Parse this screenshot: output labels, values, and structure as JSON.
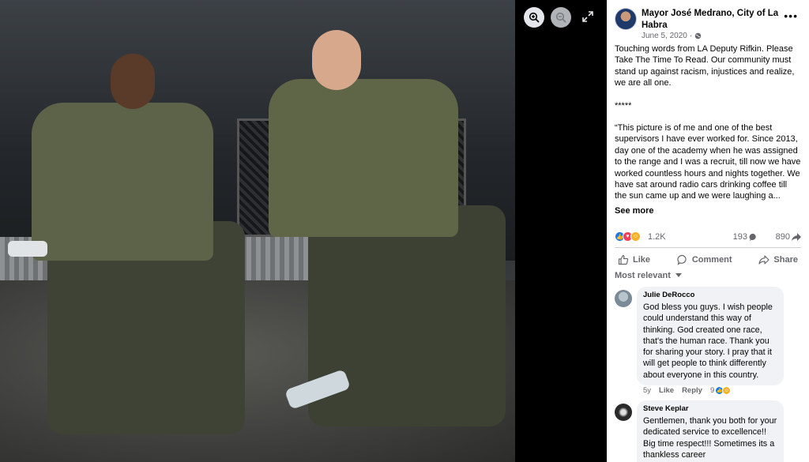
{
  "post": {
    "author": "Mayor José Medrano, City of La Habra",
    "date": "June 5, 2020 ·",
    "paragraphs": [
      "Touching words from LA Deputy Rifkin. Please Take The Time To Read. Our community must stand up against racism, injustices and realize, we are all one.",
      "*****",
      "“This picture is of me and one of the best supervisors I have ever worked for. Since 2013, day one of the academy when he was assigned to the range and I was a recruit, till now we have worked countless hours and nights together. We have sat around radio cars drinking coffee till the sun came up and we were laughing a..."
    ],
    "see_more": "See more",
    "reaction_count": "1.2K",
    "comment_count": "193",
    "share_count": "890"
  },
  "actions": {
    "like": "Like",
    "comment": "Comment",
    "share": "Share"
  },
  "sort_label": "Most relevant",
  "comments": [
    {
      "name": "Julie DeRocco",
      "text": "God bless you guys. I wish people could understand this way of thinking. God created one race, that's the human race. Thank you for sharing your story. I pray that it will get people to think differently about everyone in this country.",
      "age": "5y",
      "like": "Like",
      "reply": "Reply",
      "reactions": "9"
    },
    {
      "name": "Steve Keplar",
      "text": "Gentlemen, thank you both for your dedicated service to excellence!! Big time respect!!! Sometimes its a thankless career"
    }
  ],
  "colors": {
    "like_blue": "#1877f2",
    "love_red": "#f33e58",
    "care_yellow": "#f7b125",
    "meta_gray": "#65676b"
  },
  "icons": [
    "zoom-in-icon",
    "zoom-out-icon",
    "expand-icon",
    "globe-icon",
    "more-icon",
    "like-icon",
    "comment-icon",
    "share-icon",
    "chevron-down-icon"
  ]
}
